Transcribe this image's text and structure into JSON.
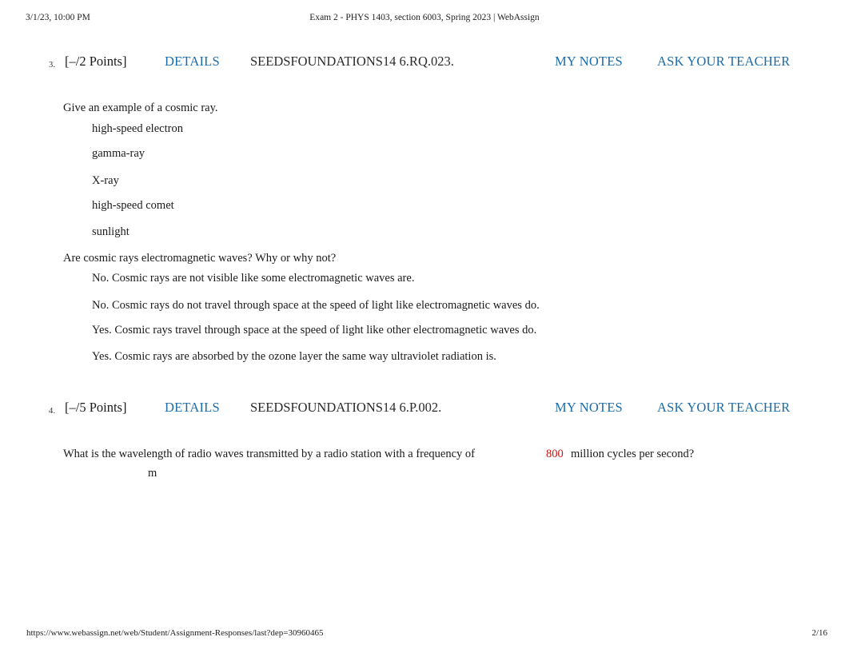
{
  "print_header": {
    "date": "3/1/23, 10:00 PM",
    "title": "Exam 2 - PHYS 1403, section 6003, Spring 2023 | WebAssign"
  },
  "colors": {
    "link_blue": "#1b6ca8",
    "answer_red": "#cc1111",
    "text": "#1a1a1a"
  },
  "questions": [
    {
      "number": "3.",
      "points": "[–/2 Points]",
      "details_label": "DETAILS",
      "code": "SEEDSFOUNDATIONS14 6.RQ.023.",
      "my_notes_label": "MY NOTES",
      "ask_teacher_label": "ASK YOUR TEACHER",
      "parts": [
        {
          "prompt": "Give an example of a cosmic ray.",
          "options": [
            "high-speed electron",
            "gamma-ray",
            "X-ray",
            "high-speed comet",
            "sunlight"
          ]
        },
        {
          "prompt": "Are cosmic rays electromagnetic waves? Why or why not?",
          "options": [
            "No. Cosmic rays are not visible like some electromagnetic waves are.",
            "No. Cosmic rays do not travel through space at the speed of light like electromagnetic waves do.",
            "Yes. Cosmic rays travel through space at the speed of light like other electromagnetic waves do.",
            "Yes. Cosmic rays are absorbed by the ozone layer the same way ultraviolet radiation is."
          ]
        }
      ]
    },
    {
      "number": "4.",
      "points": "[–/5 Points]",
      "details_label": "DETAILS",
      "code": "SEEDSFOUNDATIONS14 6.P.002.",
      "my_notes_label": "MY NOTES",
      "ask_teacher_label": "ASK YOUR TEACHER",
      "prompt_before_value": "What is the wavelength of radio waves transmitted by a radio station with a frequency of",
      "value": "800",
      "prompt_after_value": "million cycles per second?",
      "answer_unit": "m"
    }
  ],
  "print_footer": {
    "url": "https://www.webassign.net/web/Student/Assignment-Responses/last?dep=30960465",
    "page": "2/16"
  }
}
